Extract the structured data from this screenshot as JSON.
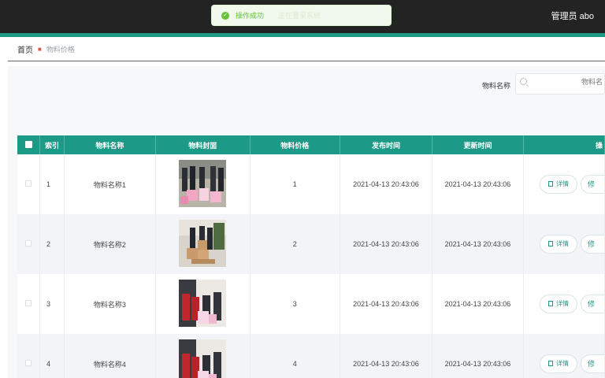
{
  "header": {
    "user_label": "管理员 abo"
  },
  "toast": {
    "message": "操作成功",
    "ghost_text": "正在登录系统"
  },
  "breadcrumb": {
    "home": "首页",
    "current": "物料价格"
  },
  "search": {
    "label": "物料名称",
    "placeholder": "物料名"
  },
  "table": {
    "headers": {
      "index": "索引",
      "name": "物料名称",
      "cover": "物料封面",
      "price": "物料价格",
      "published": "发布时间",
      "updated": "更新时间",
      "actions": "操"
    },
    "rows": [
      {
        "index": "1",
        "name": "物料名称1",
        "price": "1",
        "published": "2021-04-13 20:43:06",
        "updated": "2021-04-13 20:43:06"
      },
      {
        "index": "2",
        "name": "物料名称2",
        "price": "2",
        "published": "2021-04-13 20:43:06",
        "updated": "2021-04-13 20:43:06"
      },
      {
        "index": "3",
        "name": "物料名称3",
        "price": "3",
        "published": "2021-04-13 20:43:06",
        "updated": "2021-04-13 20:43:06"
      },
      {
        "index": "4",
        "name": "物料名称4",
        "price": "4",
        "published": "2021-04-13 20:43:06",
        "updated": "2021-04-13 20:43:06"
      }
    ],
    "detail_label": "详情",
    "edit_label": "修"
  },
  "colors": {
    "accent": "#1d9a87",
    "topbar": "#232323",
    "success": "#67c23a"
  }
}
